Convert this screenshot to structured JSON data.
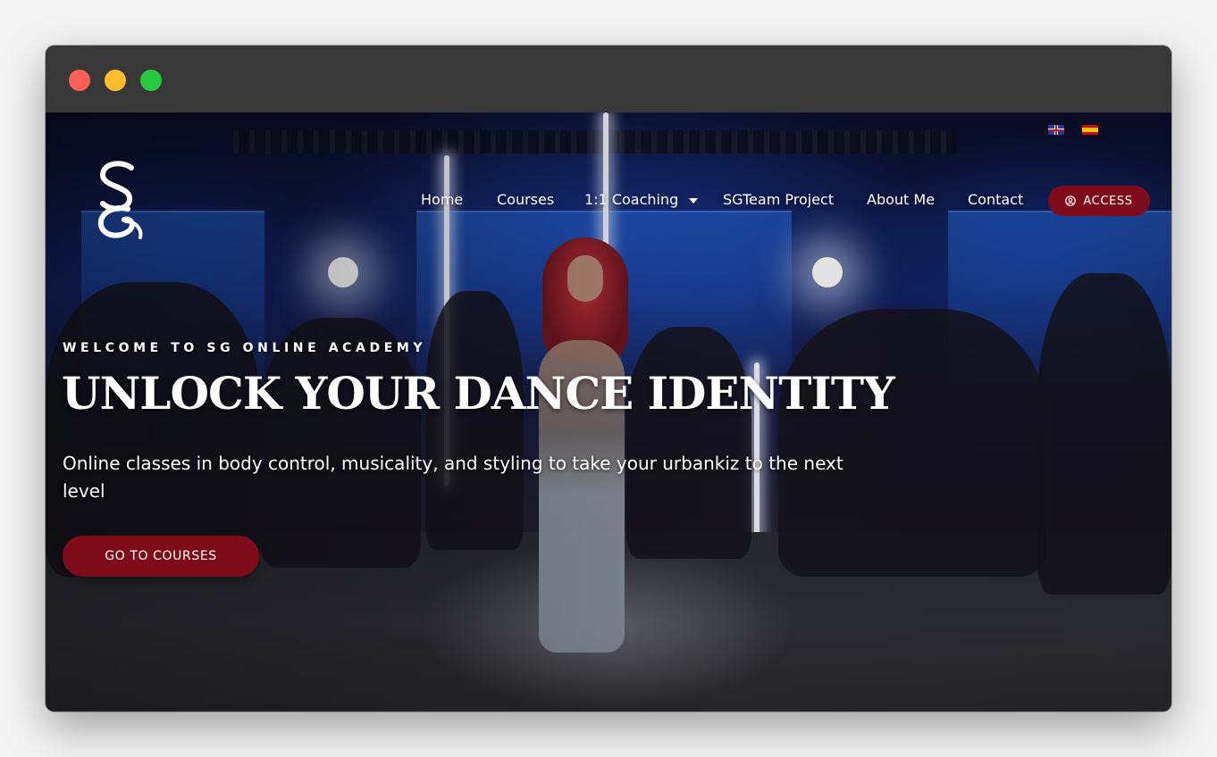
{
  "window": {
    "controls": [
      "close",
      "minimize",
      "zoom"
    ]
  },
  "header": {
    "logo_alt": "SG",
    "languages": [
      {
        "code": "en",
        "icon": "uk-flag-icon"
      },
      {
        "code": "es",
        "icon": "spain-flag-icon"
      }
    ],
    "nav": [
      {
        "label": "Home"
      },
      {
        "label": "Courses"
      },
      {
        "label": "1:1 Coaching",
        "has_dropdown": true
      },
      {
        "label": "SGTeam Project"
      },
      {
        "label": "About Me"
      },
      {
        "label": "Contact"
      }
    ],
    "access_button": {
      "label": "ACCESS",
      "icon": "user-circle-icon"
    }
  },
  "hero": {
    "eyebrow": "WELCOME TO SG ONLINE ACADEMY",
    "headline": "UNLOCK YOUR DANCE IDENTITY",
    "subtitle": "Online classes in body control, musicality, and styling to take your urbankiz to the next level",
    "cta_label": "GO TO COURSES"
  },
  "colors": {
    "accent": "#7d0b1a",
    "text": "#ffffff",
    "titlebar": "#383838"
  }
}
